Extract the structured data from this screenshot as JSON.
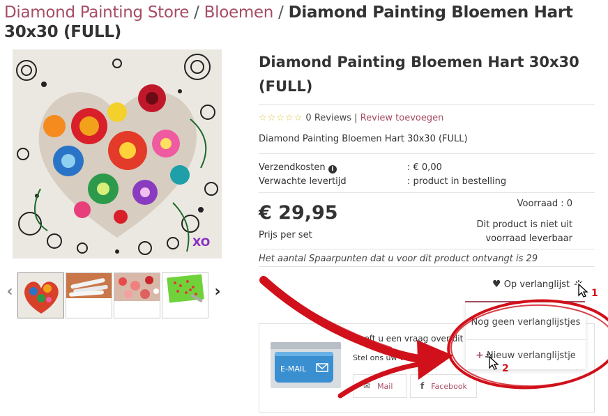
{
  "breadcrumb": {
    "store": "Diamond Painting Store",
    "sep1": " / ",
    "category": "Bloemen",
    "sep2": " / ",
    "current": "Diamond Painting Bloemen Hart 30x30 (FULL)"
  },
  "product": {
    "title": "Diamond Painting Bloemen Hart 30x30 (FULL)",
    "stars": "☆☆☆☆☆",
    "reviews": "0 Reviews",
    "reviews_sep": " | ",
    "add_review": "Review toevoegen",
    "subtitle": "Diamond Painting Bloemen Hart 30x30 (FULL)",
    "shipping_label": "Verzendkosten",
    "shipping_value": ":  € 0,00",
    "delivery_label": "Verwachte levertijd",
    "delivery_value": ":  product in bestelling",
    "price": "€ 29,95",
    "price_note": "Prijs per set",
    "stock_label": "Voorraad : 0",
    "stock_note_line1": "Dit product is niet uit",
    "stock_note_line2": "voorraad leverbaar",
    "points_note": "Het aantal Spaarpunten dat u voor dit product ontvangt is 29"
  },
  "wishlist": {
    "button_label": "Op verlanglijst",
    "empty_label": "Nog geen verlanglijstjes",
    "new_label": "Nieuw verlanglijstje",
    "plus_symbol": "+"
  },
  "contact": {
    "question": "Heeft u een vraag over dit",
    "sub": "Stel ons uw vraag",
    "email_image_text": "E-MAIL",
    "mail_label": "Mail",
    "facebook_label": "Facebook",
    "facebook_icon": "f"
  },
  "annotations": {
    "step1": "1",
    "step2": "2"
  },
  "icons": {
    "heart": "♥",
    "info": "i",
    "prev": "‹",
    "next": "›",
    "mail": "✉"
  },
  "colors": {
    "accent": "#a64d63",
    "annotation_red": "#d0101a",
    "star": "#e4c24a"
  }
}
